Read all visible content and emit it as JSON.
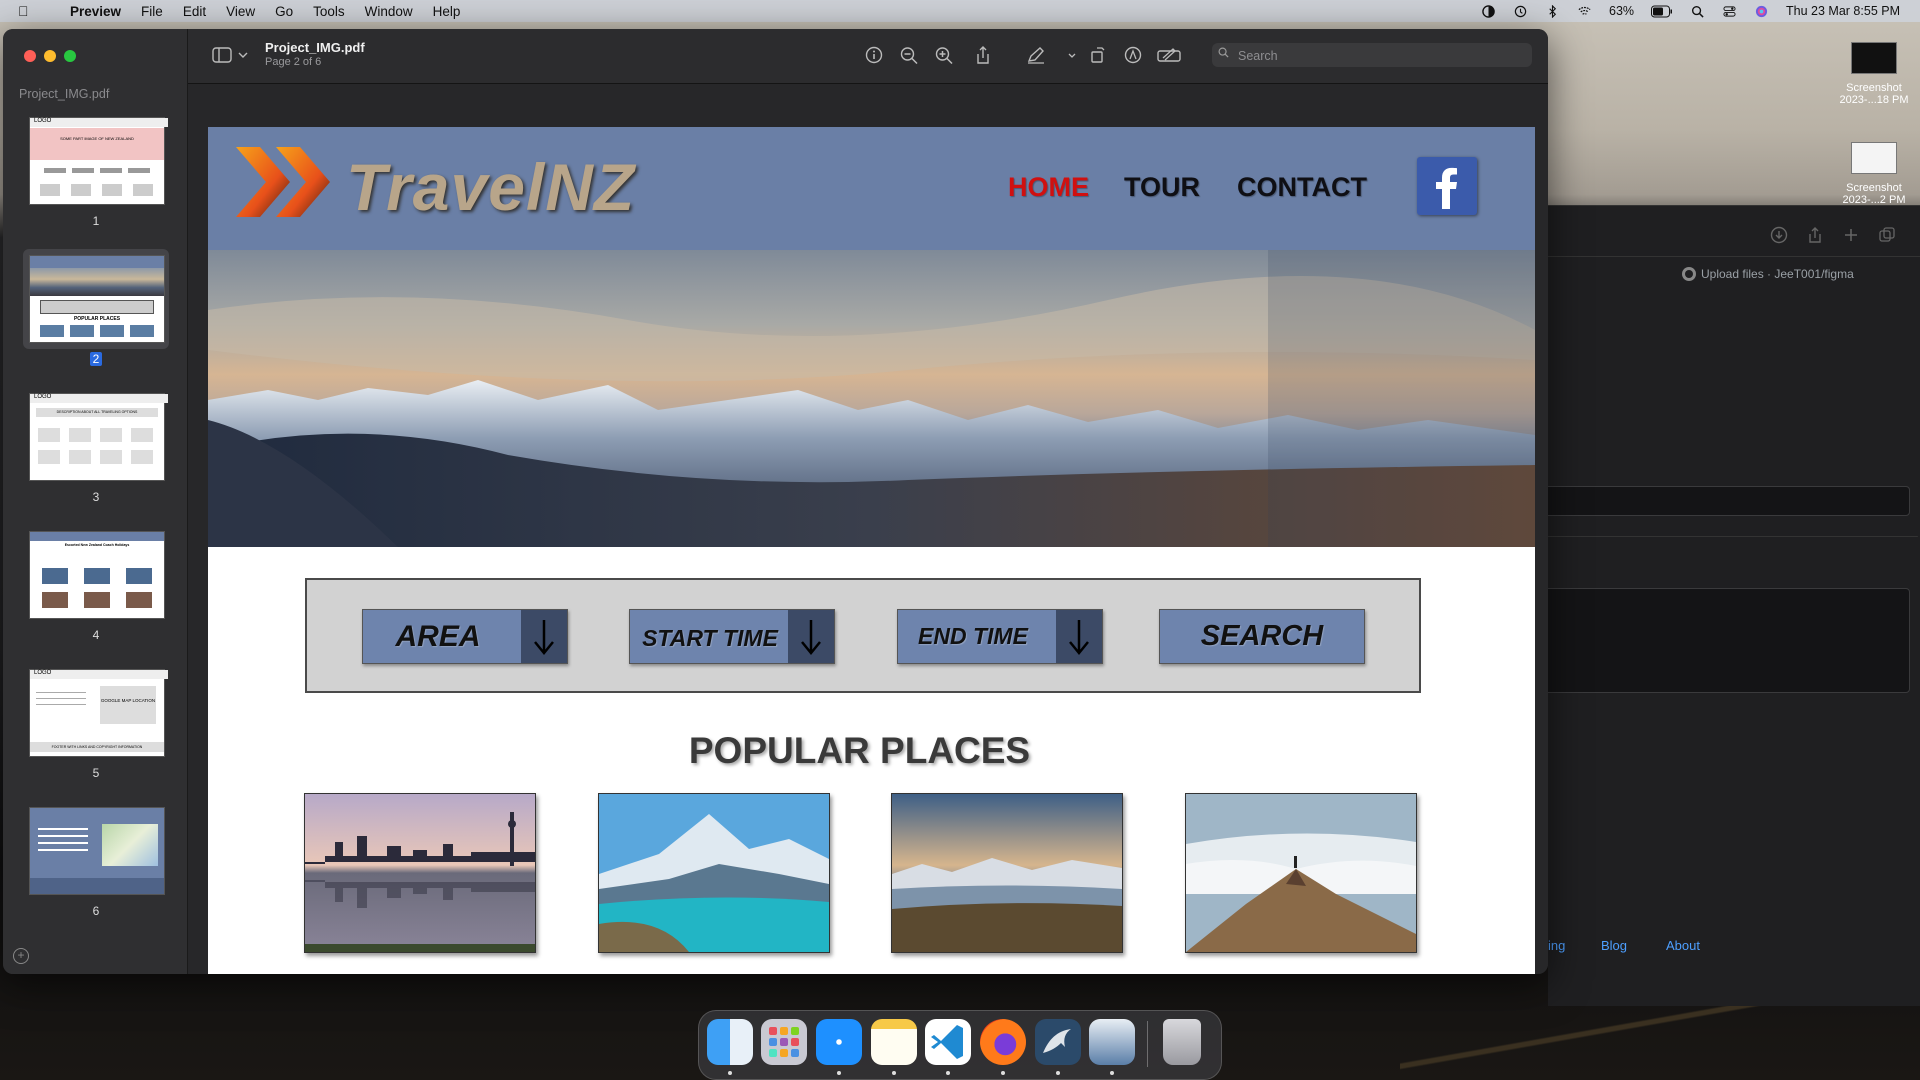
{
  "menubar": {
    "app_name": "Preview",
    "items": [
      "File",
      "Edit",
      "View",
      "Go",
      "Tools",
      "Window",
      "Help"
    ],
    "battery": "63%",
    "datetime": "Thu 23 Mar  8:55 PM"
  },
  "desktop": {
    "files": [
      {
        "name": "Screenshot 2023-...18 PM"
      },
      {
        "name": "Screenshot 2023-...2 PM"
      }
    ]
  },
  "background_window": {
    "tab_label": "Upload files · JeeT001/figma",
    "footer_links": [
      "ing",
      "Blog",
      "About"
    ]
  },
  "preview": {
    "sidebar_title": "Project_IMG.pdf",
    "pages": [
      {
        "number": "1",
        "selected": false
      },
      {
        "number": "2",
        "selected": true
      },
      {
        "number": "3",
        "selected": false
      },
      {
        "number": "4",
        "selected": false
      },
      {
        "number": "5",
        "selected": false
      },
      {
        "number": "6",
        "selected": false
      }
    ],
    "thumb_text": {
      "p1_header": "LOGO",
      "p1_banner": "SOME PART IMAGE OF NEW ZEALAND",
      "p2_title": "POPULAR PLACES",
      "p3_header": "LOGO",
      "p3_desc": "DESCRIPTION ABOUT ALL TRAVELING OPTIONS",
      "p4_title": "Escorted New Zealand Coach Holidays",
      "p5_header": "LOGO",
      "p5_map": "GOOGLE MAP LOCATION",
      "p5_footer": "FOOTER WITH LINKS AND COPYRIGHT INFORMATION"
    },
    "document_title": "Project_IMG.pdf",
    "page_indicator": "Page 2 of 6",
    "search_placeholder": "Search"
  },
  "site": {
    "logo_text": "TravelNZ",
    "nav": [
      "HOME",
      "TOUR",
      "CONTACT"
    ],
    "active_nav": "HOME",
    "filters": {
      "area": "AREA",
      "start_time": "START TIME",
      "end_time": "END TIME",
      "search": "SEARCH"
    },
    "popular_title": "POPULAR PLACES",
    "colors": {
      "header_bg": "#6a7fa6",
      "nav_active": "#d01010",
      "button_bg": "#6e84ad",
      "facebook": "#3b5bab"
    }
  }
}
